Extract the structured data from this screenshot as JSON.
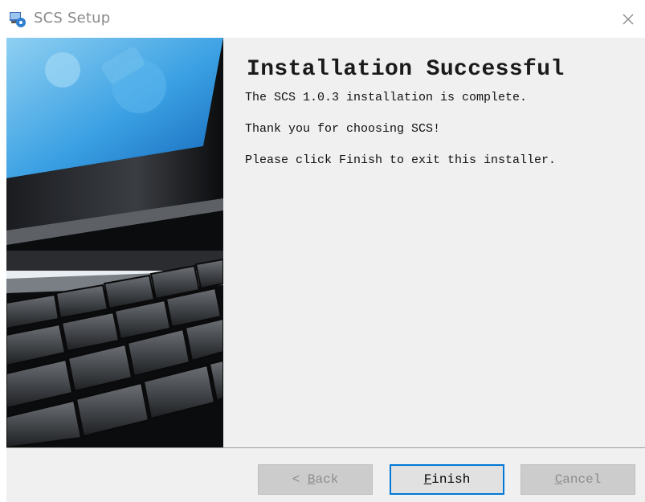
{
  "window": {
    "title": "SCS Setup",
    "icons": {
      "app": "installer-icon",
      "close": "close-icon"
    }
  },
  "main": {
    "heading": "Installation Successful",
    "lines": [
      "The SCS 1.0.3 installation is complete.",
      "Thank you for choosing SCS!",
      "Please click Finish to exit this installer."
    ]
  },
  "buttons": {
    "back": {
      "mnemonic": "B",
      "rest": "ack",
      "prefix": "< ",
      "enabled": false
    },
    "finish": {
      "mnemonic": "F",
      "rest": "inish",
      "enabled": true
    },
    "cancel": {
      "mnemonic": "C",
      "rest": "ancel",
      "enabled": false
    }
  },
  "colors": {
    "focus_border": "#0078d7",
    "panel_bg": "#f0f0f0",
    "disabled_text": "#8d8d8d"
  }
}
